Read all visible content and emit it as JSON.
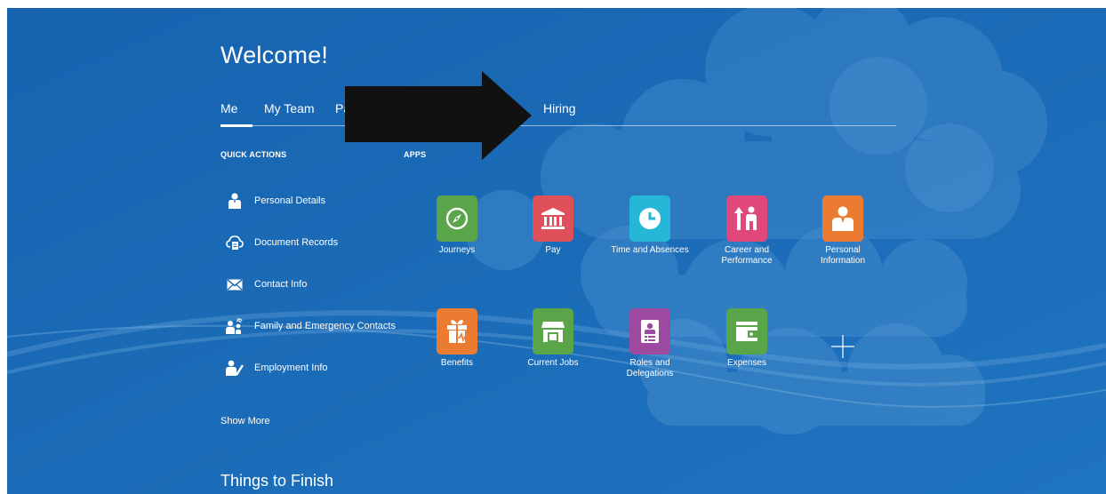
{
  "page": {
    "welcome": "Welcome!",
    "things_to_finish": "Things to Finish",
    "show_more": "Show More"
  },
  "tabs": [
    {
      "label": "Me",
      "active": true
    },
    {
      "label": "My Team"
    },
    {
      "label": "Pa"
    },
    {
      "label": "Hiring"
    }
  ],
  "quick_actions": {
    "heading": "QUICK ACTIONS",
    "items": [
      {
        "label": "Personal Details",
        "icon": "person-icon"
      },
      {
        "label": "Document Records",
        "icon": "document-cloud-icon"
      },
      {
        "label": "Contact Info",
        "icon": "envelope-icon"
      },
      {
        "label": "Family and Emergency Contacts",
        "icon": "family-icon"
      },
      {
        "label": "Employment Info",
        "icon": "person-edit-icon"
      }
    ]
  },
  "apps": {
    "heading": "APPS",
    "items": [
      {
        "label": "Journeys",
        "icon": "compass-icon",
        "color": "#5aa54a"
      },
      {
        "label": "Pay",
        "icon": "bank-icon",
        "color": "#e0505a"
      },
      {
        "label": "Time and Absences",
        "icon": "clock-icon",
        "color": "#25b6d8"
      },
      {
        "label": "Career and Performance",
        "icon": "career-icon",
        "color": "#e0487a"
      },
      {
        "label": "Personal Information",
        "icon": "person-icon",
        "color": "#ec7b32"
      },
      {
        "label": "Benefits",
        "icon": "gift-icon",
        "color": "#ec7b32"
      },
      {
        "label": "Current Jobs",
        "icon": "store-icon",
        "color": "#5aa54a"
      },
      {
        "label": "Roles and Delegations",
        "icon": "badge-icon",
        "color": "#9b4aa0"
      },
      {
        "label": "Expenses",
        "icon": "wallet-icon",
        "color": "#5aa54a"
      }
    ],
    "add_icon": "plus-icon"
  },
  "colors": {
    "background": "#1a6ab5",
    "annotation_arrow": "#111111"
  }
}
